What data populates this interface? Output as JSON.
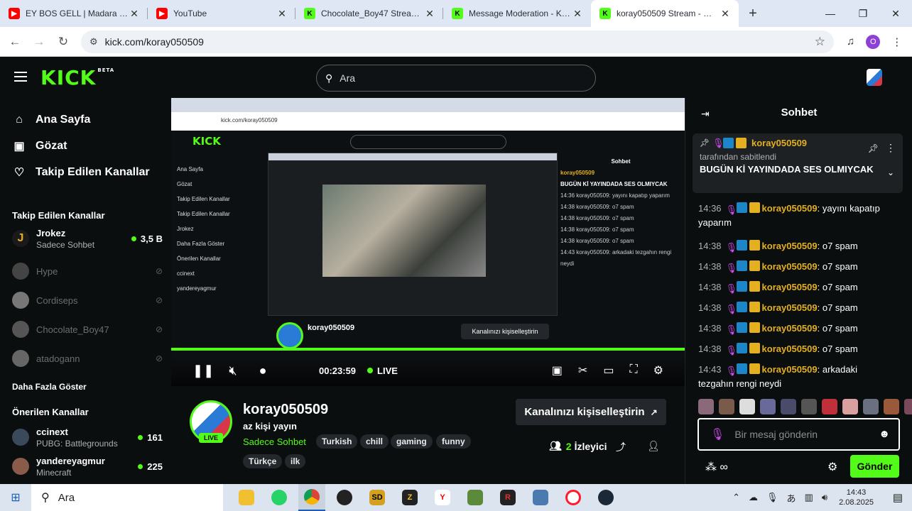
{
  "browser": {
    "tabs": [
      {
        "title": "EY BOS GELL | Madara Oldul",
        "favicon": "youtube-icon",
        "active": false
      },
      {
        "title": "YouTube",
        "favicon": "youtube-icon",
        "active": false
      },
      {
        "title": "Chocolate_Boy47 Stream - W",
        "favicon": "kick-icon",
        "active": false
      },
      {
        "title": "Message Moderation - Kick",
        "favicon": "kick-icon",
        "active": false
      },
      {
        "title": "koray050509 Stream - Watc",
        "favicon": "kick-icon",
        "active": true
      }
    ],
    "url": "kick.com/koray050509",
    "profile_initial": "O"
  },
  "kick": {
    "logo": "KICK",
    "logo_beta": "BETA",
    "search_placeholder": "Ara"
  },
  "sidebar": {
    "nav": [
      {
        "label": "Ana Sayfa",
        "icon": "home-icon"
      },
      {
        "label": "Gözat",
        "icon": "browse-icon"
      },
      {
        "label": "Takip Edilen Kanallar",
        "icon": "heart-icon"
      }
    ],
    "followed_heading": "Takip Edilen Kanallar",
    "followed": [
      {
        "name": "Jrokez",
        "category": "Sadece Sohbet",
        "viewers": "3,5 B",
        "live": true
      },
      {
        "name": "Hype",
        "live": false
      },
      {
        "name": "Cordiseps",
        "live": false
      },
      {
        "name": "Chocolate_Boy47",
        "live": false
      },
      {
        "name": "atadogann",
        "live": false
      }
    ],
    "show_more": "Daha Fazla Göster",
    "recommended_heading": "Önerilen Kanallar",
    "recommended": [
      {
        "name": "ccinext",
        "category": "PUBG: Battlegrounds",
        "viewers": "161"
      },
      {
        "name": "yandereyagmur",
        "category": "Minecraft",
        "viewers": "225"
      }
    ]
  },
  "player": {
    "time": "00:23:59",
    "live_label": "LIVE",
    "nested": {
      "url": "kick.com/koray050509",
      "nav": [
        "Ana Sayfa",
        "Gözat",
        "Takip Edilen Kanallar",
        "Takip Edilen Kanallar",
        "Jrokez",
        "Daha Fazla Göster",
        "Önerilen Kanallar",
        "ccinext",
        "yandereyagmur"
      ],
      "chat_title": "Sohbet",
      "chat_lines": [
        "koray050509",
        "BUGÜN Kİ YAYINDADA SES OLMIYCAK",
        "14:36 koray050509: yayını kapatıp yaparım",
        "14:38 koray050509: o7 spam",
        "14:38 koray050509: o7 spam",
        "14:38 koray050509: o7 spam",
        "14:38 koray050509: o7 spam",
        "14:43 koray050509: arkadaki tezgahın rengi neydi"
      ],
      "channel": "koray050509",
      "custom": "Kanalınızı kişiselleştirin",
      "send": "Gönder",
      "input": "Bir mesaj gönderin"
    }
  },
  "channel": {
    "name": "koray050509",
    "title": "az kişi yayın",
    "category": "Sadece Sohbet",
    "live_badge": "LIVE",
    "tags": [
      "Turkish",
      "chill",
      "gaming",
      "funny",
      "Türkçe",
      "ilk"
    ],
    "customize": "Kanalınızı kişiselleştirin",
    "viewer_count": "2",
    "viewer_label": "İzleyici"
  },
  "chat": {
    "title": "Sohbet",
    "top_fragment": "...",
    "pinned": {
      "user": "koray050509",
      "by": "tarafından sabitlendi",
      "message": "BUGÜN Kİ YAYINDADA SES OLMIYCAK"
    },
    "partial_line": {
      "time": "14:36",
      "user": "..."
    },
    "messages": [
      {
        "time": "14:36",
        "user": "koray050509",
        "text": "yayını kapatıp",
        "text2": "yaparım"
      },
      {
        "time": "14:38",
        "user": "koray050509",
        "text": "o7 spam"
      },
      {
        "time": "14:38",
        "user": "koray050509",
        "text": "o7 spam"
      },
      {
        "time": "14:38",
        "user": "koray050509",
        "text": "o7 spam"
      },
      {
        "time": "14:38",
        "user": "koray050509",
        "text": "o7 spam"
      },
      {
        "time": "14:38",
        "user": "koray050509",
        "text": "o7 spam"
      },
      {
        "time": "14:38",
        "user": "koray050509",
        "text": "o7 spam"
      },
      {
        "time": "14:43",
        "user": "koray050509",
        "text": "arkadaki",
        "text2": "tezgahın rengi neydi"
      }
    ],
    "input_placeholder": "Bir mesaj gönderin",
    "send_label": "Gönder"
  },
  "taskbar": {
    "search_placeholder": "Ara",
    "apps": [
      "file-explorer-icon",
      "whatsapp-icon",
      "chrome-icon",
      "chatgpt-icon",
      "sd-app-icon",
      "z-app-icon",
      "yandex-icon",
      "minecraft-icon",
      "r-app-icon",
      "network-icon",
      "opera-icon",
      "steam-icon"
    ],
    "time": "14:43",
    "date": "2.08.2025"
  },
  "colors": {
    "kick_green": "#53fc18",
    "mod_gold": "#e4b020",
    "background": "#0b0e0f"
  }
}
